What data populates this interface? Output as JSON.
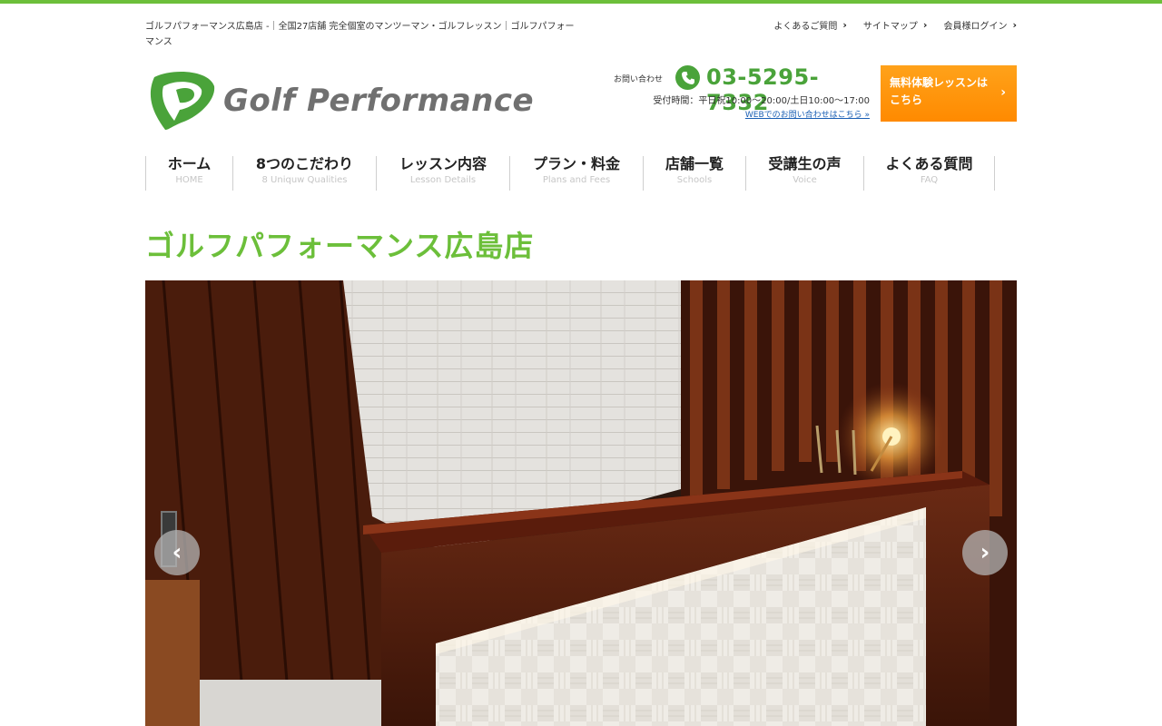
{
  "header": {
    "site_description": "ゴルフパフォーマンス広島店 -｜全国27店舗 完全個室のマンツーマン・ゴルフレッスン｜ゴルフパフォーマンス",
    "utility_links": [
      {
        "label": "よくあるご質問"
      },
      {
        "label": "サイトマップ"
      },
      {
        "label": "会員様ログイン"
      }
    ],
    "logo_text": "Golf Performance"
  },
  "contact": {
    "label": "お問い合わせ",
    "phone": "03-5295-7332",
    "hours": "受付時間：平日祝10:00〜20:00/土日10:00〜17:00",
    "web_link": "WEBでのお問い合わせはこちら »",
    "cta_label": "無料体験レッスンはこちら"
  },
  "nav": {
    "items": [
      {
        "jp": "ホーム",
        "en": "HOME"
      },
      {
        "jp": "8つのこだわり",
        "en": "8 Uniquw Qualities"
      },
      {
        "jp": "レッスン内容",
        "en": "Lesson Details"
      },
      {
        "jp": "プラン・料金",
        "en": "Plans and Fees"
      },
      {
        "jp": "店舗一覧",
        "en": "Schools"
      },
      {
        "jp": "受講生の声",
        "en": "Voice"
      },
      {
        "jp": "よくある質問",
        "en": "FAQ"
      }
    ]
  },
  "page": {
    "title": "ゴルフパフォーマンス広島店"
  },
  "slider": {
    "prev_icon": "chevron-left-icon",
    "next_icon": "chevron-right-icon",
    "prev_glyph": "‹",
    "next_glyph": "›"
  },
  "colors": {
    "brand_green": "#6cbf3a",
    "phone_green": "#4aa33a",
    "cta_orange": "#ff8a00"
  }
}
